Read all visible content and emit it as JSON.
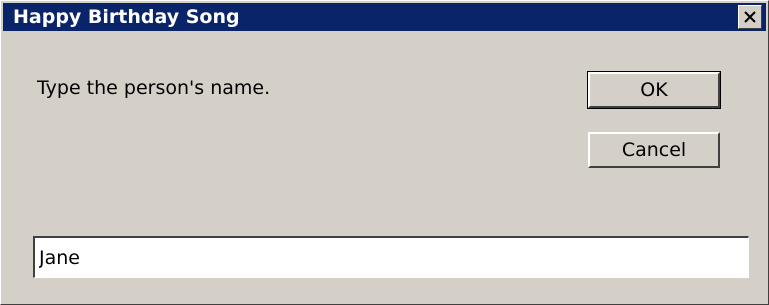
{
  "window": {
    "title": "Happy Birthday Song",
    "title_bar_color": "#0a246a",
    "background_color": "#d4d0c8"
  },
  "dialog": {
    "prompt": "Type the person's name.",
    "ok_label": "OK",
    "cancel_label": "Cancel",
    "name_value": "Jane",
    "name_placeholder": ""
  },
  "icons": {
    "close": "close-icon"
  }
}
